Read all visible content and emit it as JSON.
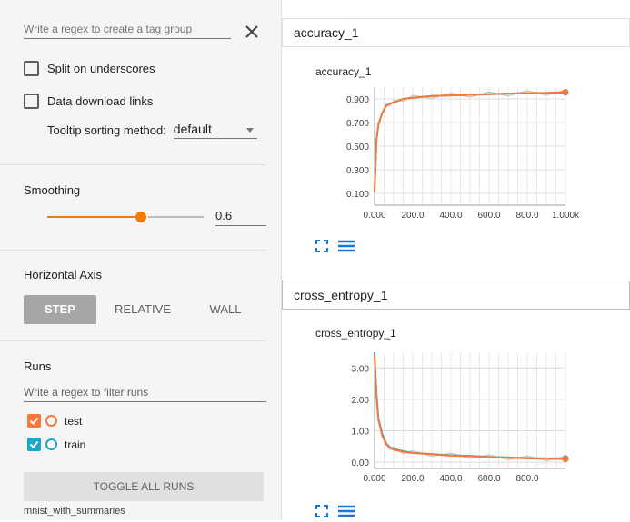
{
  "sidebar": {
    "regex_placeholder": "Write a regex to create a tag group",
    "split_underscores_label": "Split on underscores",
    "data_download_label": "Data download links",
    "tooltip_label": "Tooltip sorting method:",
    "tooltip_value": "default",
    "smoothing_title": "Smoothing",
    "smoothing_value": "0.6",
    "smoothing_fraction": 0.6,
    "horizontal_axis_title": "Horizontal Axis",
    "axis_options": [
      "STEP",
      "RELATIVE",
      "WALL"
    ],
    "axis_selected": "STEP",
    "runs_title": "Runs",
    "runs_filter_placeholder": "Write a regex to filter runs",
    "runs": [
      {
        "name": "test",
        "checkbox_color": "#f4793b",
        "circle_color": "#f4793b",
        "checked": true
      },
      {
        "name": "train",
        "checkbox_color": "#1aa7c9",
        "circle_color": "#1aa7c9",
        "checked": true
      }
    ],
    "toggle_all_label": "TOGGLE ALL RUNS",
    "footer": "mnist_with_summaries"
  },
  "main": {
    "cards": [
      {
        "header": "accuracy_1",
        "chart_title": "accuracy_1"
      },
      {
        "header": "cross_entropy_1",
        "chart_title": "cross_entropy_1"
      }
    ]
  },
  "colors": {
    "accent": "#f57c00",
    "train": "#1aa7c9",
    "test": "#f4793b"
  },
  "icons": {
    "close": "close-icon",
    "fit": "fit-domain-icon",
    "lines": "toggle-log-icon"
  },
  "chart_data": [
    {
      "type": "line",
      "title": "accuracy_1",
      "xlabel": "",
      "ylabel": "",
      "xlim": [
        0,
        1000
      ],
      "ylim": [
        0.0,
        1.0
      ],
      "y_ticks": [
        "0.100",
        "0.300",
        "0.500",
        "0.700",
        "0.900"
      ],
      "x_ticks": [
        "0.000",
        "200.0",
        "400.0",
        "600.0",
        "800.0",
        "1.000k"
      ],
      "series": [
        {
          "name": "train",
          "x": [
            0,
            10,
            20,
            40,
            60,
            80,
            100,
            150,
            200,
            300,
            400,
            500,
            600,
            700,
            800,
            900,
            1000
          ],
          "y": [
            0.11,
            0.55,
            0.68,
            0.78,
            0.84,
            0.86,
            0.87,
            0.9,
            0.91,
            0.925,
            0.93,
            0.935,
            0.94,
            0.945,
            0.95,
            0.95,
            0.955
          ]
        },
        {
          "name": "test",
          "x": [
            0,
            10,
            20,
            40,
            60,
            80,
            100,
            150,
            200,
            300,
            400,
            500,
            600,
            700,
            800,
            900,
            1000
          ],
          "y": [
            0.11,
            0.55,
            0.68,
            0.78,
            0.84,
            0.86,
            0.87,
            0.9,
            0.91,
            0.925,
            0.93,
            0.935,
            0.94,
            0.945,
            0.95,
            0.952,
            0.958
          ]
        }
      ]
    },
    {
      "type": "line",
      "title": "cross_entropy_1",
      "xlabel": "",
      "ylabel": "",
      "xlim": [
        0,
        1000
      ],
      "ylim": [
        -0.2,
        3.5
      ],
      "y_ticks": [
        "0.00",
        "1.00",
        "2.00",
        "3.00"
      ],
      "x_ticks": [
        "0.000",
        "200.0",
        "400.0",
        "600.0",
        "800.0"
      ],
      "series": [
        {
          "name": "train",
          "x": [
            0,
            10,
            20,
            40,
            60,
            80,
            100,
            150,
            200,
            300,
            400,
            500,
            600,
            700,
            800,
            900,
            1000
          ],
          "y": [
            3.5,
            2.2,
            1.4,
            0.9,
            0.6,
            0.48,
            0.42,
            0.35,
            0.3,
            0.26,
            0.22,
            0.2,
            0.17,
            0.15,
            0.13,
            0.12,
            0.12
          ]
        },
        {
          "name": "test",
          "x": [
            0,
            10,
            20,
            40,
            60,
            80,
            100,
            150,
            200,
            300,
            400,
            500,
            600,
            700,
            800,
            900,
            1000
          ],
          "y": [
            3.4,
            2.1,
            1.35,
            0.85,
            0.58,
            0.46,
            0.4,
            0.33,
            0.29,
            0.25,
            0.21,
            0.19,
            0.16,
            0.14,
            0.12,
            0.11,
            0.1
          ]
        }
      ]
    }
  ]
}
